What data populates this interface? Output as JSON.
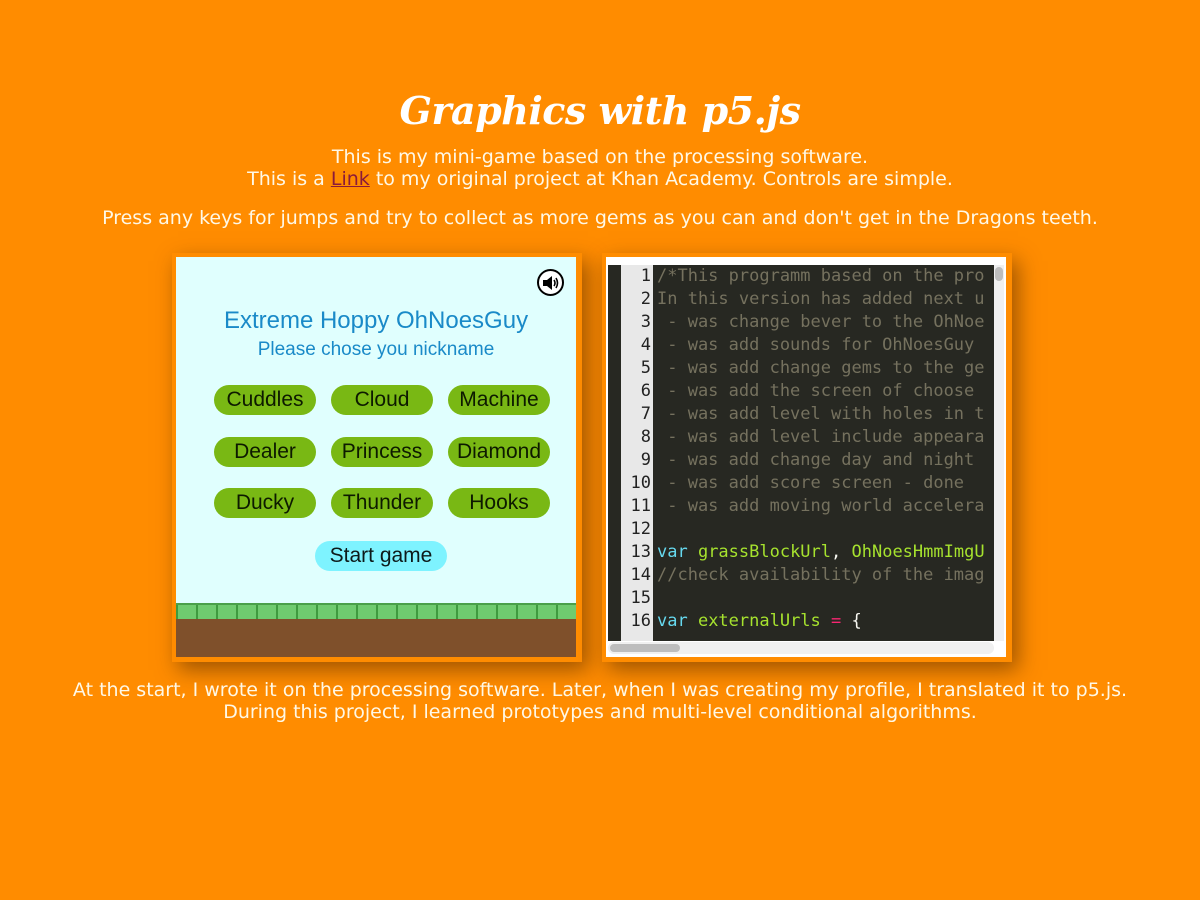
{
  "header": {
    "title": "Graphics with p5.js",
    "intro_line1": "This is my mini-game based on the processing software.",
    "intro_line2_before": "This is a ",
    "intro_link": "Link",
    "intro_line2_after": " to my original project at Khan Academy. Controls are simple.",
    "instructions": "Press any keys for jumps and try to collect as more gems as you can and don't get in the Dragons teeth."
  },
  "game": {
    "sound_icon": "speaker-icon",
    "title": "Extreme Hoppy OhNoesGuy",
    "subtitle": "Please chose you nickname",
    "nicknames": [
      "Cuddles",
      "Cloud",
      "Machine",
      "Dealer",
      "Princess",
      "Diamond",
      "Ducky",
      "Thunder",
      "Hooks"
    ],
    "start_label": "Start game",
    "colors": {
      "sky": "#e0fffe",
      "nickname_button": "#79b814",
      "start_button": "#7ef3ff",
      "title_text": "#1a8ac8",
      "grass": "#5cb85c",
      "dirt": "#7f502b"
    }
  },
  "code": {
    "lines": [
      {
        "num": "1",
        "text": "/*This programm based on the pro"
      },
      {
        "num": "2",
        "text": "In this version has added next u"
      },
      {
        "num": "3",
        "text": " - was change bever to the OhNoe"
      },
      {
        "num": "4",
        "text": " - was add sounds for OhNoesGuy "
      },
      {
        "num": "5",
        "text": " - was add change gems to the ge"
      },
      {
        "num": "6",
        "text": " - was add the screen of choose "
      },
      {
        "num": "7",
        "text": " - was add level with holes in t"
      },
      {
        "num": "8",
        "text": " - was add level include appeara"
      },
      {
        "num": "9",
        "text": " - was add change day and night "
      },
      {
        "num": "10",
        "text": " - was add score screen - done"
      },
      {
        "num": "11",
        "text": " - was add moving world accelera"
      },
      {
        "num": "12",
        "text": ""
      },
      {
        "num": "13",
        "kw": "var ",
        "var": "grassBlockUrl",
        "plain": ", ",
        "var2": "OhNoesHmmImgU"
      },
      {
        "num": "14",
        "text": "//check availability of the imag"
      },
      {
        "num": "15",
        "text": ""
      },
      {
        "num": "16",
        "kw": "var ",
        "var": "externalUrls",
        "op": " = ",
        "plain": "{"
      }
    ],
    "colors": {
      "background": "#272822",
      "comment": "#75715e",
      "keyword": "#66d9ef",
      "variable": "#a6e22e",
      "operator": "#f92672"
    }
  },
  "footer": {
    "line1": "At the start, I wrote it on the processing software. Later, when I was creating my profile, I translated it to p5.js.",
    "line2": "During this project, I learned prototypes and multi-level conditional algorithms."
  },
  "colors": {
    "page_background": "#ff8c00",
    "link": "#8b1a3a"
  }
}
